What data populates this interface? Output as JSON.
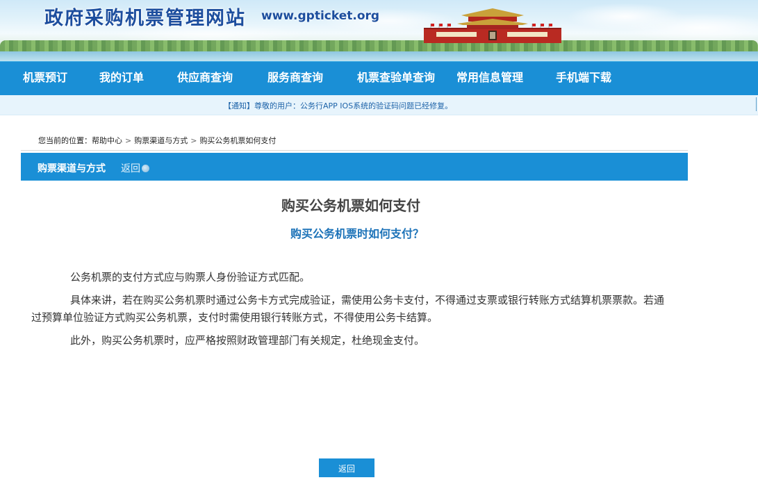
{
  "header": {
    "site_title": "政府采购机票管理网站",
    "site_url": "www.gpticket.org"
  },
  "nav": {
    "items": [
      {
        "label": "机票预订"
      },
      {
        "label": "我的订单"
      },
      {
        "label": "供应商查询"
      },
      {
        "label": "服务商查询"
      },
      {
        "label": "机票查验单查询"
      },
      {
        "label": "常用信息管理"
      },
      {
        "label": "手机端下载"
      }
    ]
  },
  "notice": {
    "text": "【通知】尊敬的用户：公务行APP IOS系统的验证码问题已经修复。"
  },
  "breadcrumb": {
    "prefix": "您当前的位置：",
    "items": [
      "帮助中心",
      "购票渠道与方式",
      "购买公务机票如何支付"
    ],
    "separator": ">"
  },
  "section": {
    "title": "购票渠道与方式",
    "back_label": "返回"
  },
  "article": {
    "title": "购买公务机票如何支付",
    "question": "购买公务机票时如何支付？",
    "paragraphs": [
      "公务机票的支付方式应与购票人身份验证方式匹配。",
      "具体来讲，若在购买公务机票时通过公务卡方式完成验证，需使用公务卡支付，不得通过支票或银行转账方式结算机票票款。若通过预算单位验证方式购买公务机票，支付时需使用银行转账方式，不得使用公务卡结算。",
      "此外，购买公务机票时，应严格按照财政管理部门有关规定，杜绝现金支付。"
    ]
  },
  "footer": {
    "back_button_label": "返回"
  },
  "colors": {
    "nav_bg": "#1a8fd6",
    "notice_bg": "#e7f4fc",
    "title_blue": "#1d4e9e",
    "question_blue": "#1b72b8"
  }
}
